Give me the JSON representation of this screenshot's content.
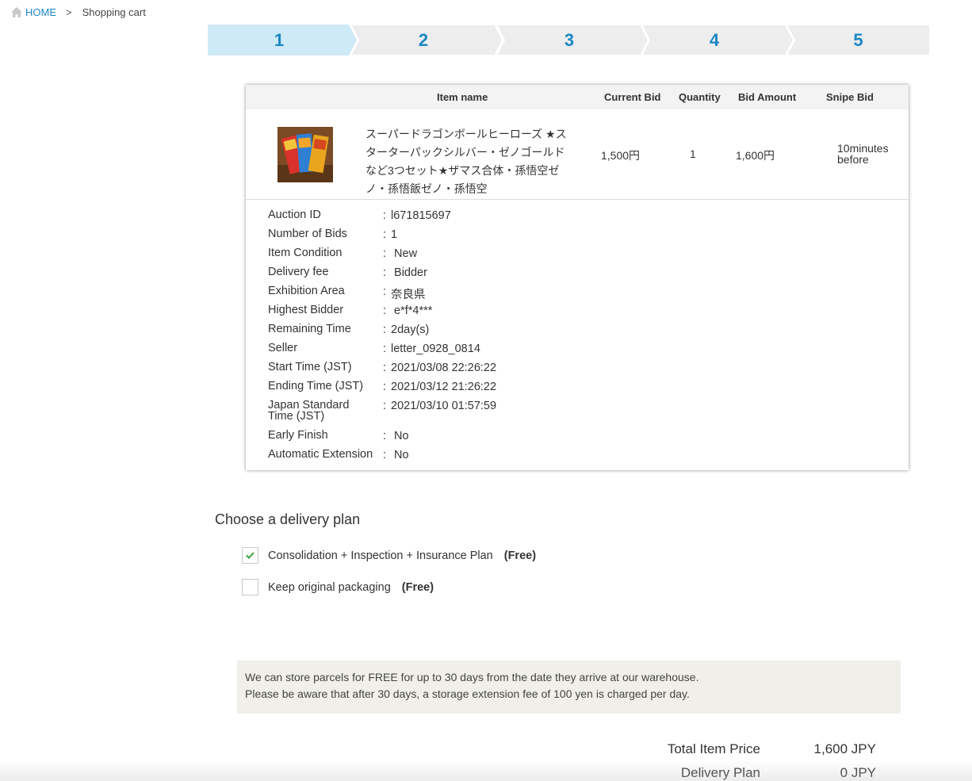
{
  "breadcrumb": {
    "home": "HOME",
    "separator": ">",
    "current": "Shopping cart"
  },
  "steps": [
    {
      "label": "1",
      "active": true
    },
    {
      "label": "2",
      "active": false
    },
    {
      "label": "3",
      "active": false
    },
    {
      "label": "4",
      "active": false
    },
    {
      "label": "5",
      "active": false
    }
  ],
  "colors": {
    "accent": "#1b87c4",
    "step_active": "#cdeaf6",
    "step_inactive": "#ededed",
    "check": "#3aa53a"
  },
  "table": {
    "headers": {
      "item_name": "Item name",
      "current_bid": "Current Bid",
      "quantity": "Quantity",
      "bid_amount": "Bid Amount",
      "snipe_bid": "Snipe Bid"
    },
    "item": {
      "name": "スーパードラゴンボールヒーローズ ★スターターパックシルバー・ゼノゴールドなど3つセット★ザマス合体・孫悟空ゼノ・孫悟飯ゼノ・孫悟空",
      "current_bid": "1,500円",
      "quantity": "1",
      "bid_amount": "1,600円",
      "snipe_bid_line1": "10minutes",
      "snipe_bid_line2": "before"
    }
  },
  "details": [
    {
      "label": "Auction ID",
      "value": "l671815697"
    },
    {
      "label": "Number of Bids",
      "value": "1"
    },
    {
      "label": "Item Condition",
      "value": " New"
    },
    {
      "label": "Delivery fee",
      "value": " Bidder"
    },
    {
      "label": "Exhibition Area",
      "value": "奈良県"
    },
    {
      "label": "Highest Bidder",
      "value": " e*f*4***"
    },
    {
      "label": "Remaining Time",
      "value": "2day(s)"
    },
    {
      "label": "Seller",
      "value": "letter_0928_0814"
    },
    {
      "label": "Start Time (JST)",
      "value": "2021/03/08 22:26:22"
    },
    {
      "label": "Ending Time (JST)",
      "value": "2021/03/12 21:26:22"
    },
    {
      "label": "Japan Standard Time (JST)",
      "value": "2021/03/10 01:57:59"
    },
    {
      "label": "Early Finish",
      "value": " No"
    },
    {
      "label": "Automatic Extension",
      "value": " No"
    }
  ],
  "details_colon": ":",
  "delivery": {
    "title": "Choose a delivery plan",
    "options": [
      {
        "label": "Consolidation + Inspection + Insurance Plan",
        "price": "(Free)",
        "checked": true
      },
      {
        "label": "Keep original packaging",
        "price": "(Free)",
        "checked": false
      }
    ]
  },
  "notice": {
    "line1": "We can store parcels for FREE for up to 30 days from the date they arrive at our warehouse.",
    "line2": "Please be aware that after 30 days, a storage extension fee of 100 yen is charged per day."
  },
  "totals": [
    {
      "label": "Total Item Price",
      "value": "1,600 JPY"
    },
    {
      "label": "Delivery Plan",
      "value": "0 JPY"
    }
  ]
}
